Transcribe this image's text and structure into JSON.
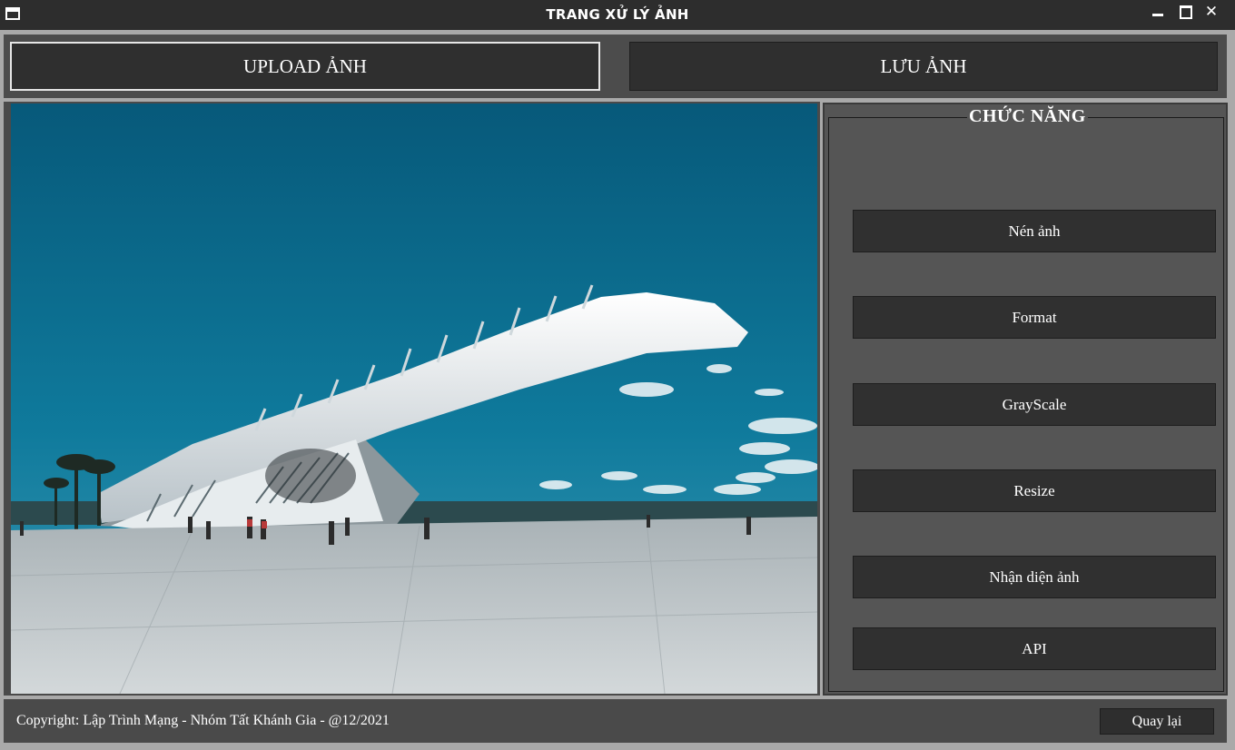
{
  "window": {
    "title": "TRANG XỬ LÝ ẢNH",
    "app_icon": "window-icon",
    "controls": [
      "minimize-icon",
      "maximize-icon",
      "close-icon"
    ],
    "close_glyph": "✕"
  },
  "toolbar": {
    "upload_label": "UPLOAD ẢNH",
    "save_label": "LƯU ẢNH"
  },
  "preview": {
    "content": "photo of a white futuristic museum building under a blue sky with people on a plaza"
  },
  "functions": {
    "group_title": "CHỨC NĂNG",
    "buttons": [
      {
        "label": "Nén ảnh"
      },
      {
        "label": "Format"
      },
      {
        "label": "GrayScale"
      },
      {
        "label": "Resize"
      },
      {
        "label": "Nhận diện ảnh"
      },
      {
        "label": "API"
      }
    ]
  },
  "footer": {
    "copyright": "Copyright: Lập Trình Mạng - Nhóm Tất Khánh Gia - @12/2021",
    "back_label": "Quay lại"
  },
  "colors": {
    "titlebar": "#2d2d2d",
    "panel": "#4c4c4c",
    "button": "#303030",
    "sky": "#0f6e8f"
  }
}
